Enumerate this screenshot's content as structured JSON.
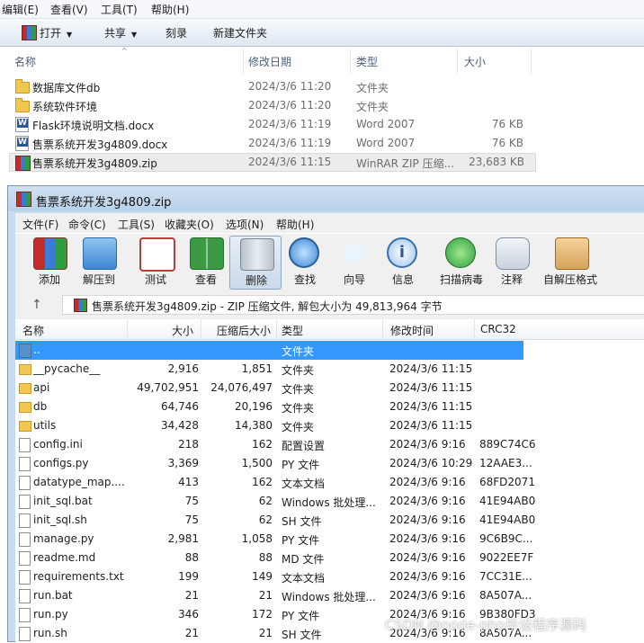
{
  "explorer": {
    "menu": [
      "编辑(E)",
      "查看(V)",
      "工具(T)",
      "帮助(H)"
    ],
    "toolbar": {
      "open": "打开",
      "share": "共享",
      "burn": "刻录",
      "new_folder": "新建文件夹"
    },
    "columns": {
      "name": "名称",
      "modified": "修改日期",
      "type": "类型",
      "size": "大小"
    },
    "rows": [
      {
        "name": "数据库文件db",
        "modified": "2024/3/6 11:20",
        "type": "文件夹",
        "size": "",
        "icon": "folder-icon"
      },
      {
        "name": "系统软件环境",
        "modified": "2024/3/6 11:20",
        "type": "文件夹",
        "size": "",
        "icon": "folder-icon"
      },
      {
        "name": "Flask环境说明文档.docx",
        "modified": "2024/3/6 11:19",
        "type": "Word 2007",
        "size": "76 KB",
        "icon": "word-document-icon"
      },
      {
        "name": "售票系统开发3g4809.docx",
        "modified": "2024/3/6 11:19",
        "type": "Word 2007",
        "size": "76 KB",
        "icon": "word-document-icon"
      },
      {
        "name": "售票系统开发3g4809.zip",
        "modified": "2024/3/6 11:15",
        "type": "WinRAR ZIP 压缩...",
        "size": "23,683 KB",
        "icon": "winrar-archive-icon"
      }
    ]
  },
  "winrar": {
    "title": "售票系统开发3g4809.zip",
    "menu": [
      "文件(F)",
      "命令(C)",
      "工具(S)",
      "收藏夹(O)",
      "选项(N)",
      "帮助(H)"
    ],
    "tools": [
      {
        "label": "添加",
        "icon": "add-archive-icon"
      },
      {
        "label": "解压到",
        "icon": "extract-to-folder-icon"
      },
      {
        "label": "测试",
        "icon": "test-checklist-icon"
      },
      {
        "label": "查看",
        "icon": "view-book-icon"
      },
      {
        "label": "删除",
        "icon": "delete-trash-icon"
      },
      {
        "label": "查找",
        "icon": "find-magnifier-icon"
      },
      {
        "label": "向导",
        "icon": "wizard-wand-icon"
      },
      {
        "label": "信息",
        "icon": "info-icon"
      },
      {
        "label": "扫描病毒",
        "icon": "virus-scan-icon"
      },
      {
        "label": "注释",
        "icon": "comment-icon"
      },
      {
        "label": "自解压格式",
        "icon": "sfx-box-icon"
      }
    ],
    "path": "售票系统开发3g4809.zip - ZIP 压缩文件, 解包大小为 49,813,964 字节",
    "columns": {
      "name": "名称",
      "size": "大小",
      "packed": "压缩后大小",
      "type": "类型",
      "modified": "修改时间",
      "crc": "CRC32"
    },
    "rows": [
      {
        "name": "..",
        "size": "",
        "packed": "",
        "type": "文件夹",
        "modified": "",
        "crc": "",
        "kind": "up"
      },
      {
        "name": "__pycache__",
        "size": "2,916",
        "packed": "1,851",
        "type": "文件夹",
        "modified": "2024/3/6 11:15",
        "crc": "",
        "kind": "folder"
      },
      {
        "name": "api",
        "size": "49,702,951",
        "packed": "24,076,497",
        "type": "文件夹",
        "modified": "2024/3/6 11:15",
        "crc": "",
        "kind": "folder"
      },
      {
        "name": "db",
        "size": "64,746",
        "packed": "20,196",
        "type": "文件夹",
        "modified": "2024/3/6 11:15",
        "crc": "",
        "kind": "folder"
      },
      {
        "name": "utils",
        "size": "34,428",
        "packed": "14,380",
        "type": "文件夹",
        "modified": "2024/3/6 11:15",
        "crc": "",
        "kind": "folder"
      },
      {
        "name": "config.ini",
        "size": "218",
        "packed": "162",
        "type": "配置设置",
        "modified": "2024/3/6 9:16",
        "crc": "889C74C6",
        "kind": "file"
      },
      {
        "name": "configs.py",
        "size": "3,369",
        "packed": "1,500",
        "type": "PY 文件",
        "modified": "2024/3/6 10:29",
        "crc": "12AAE3...",
        "kind": "file"
      },
      {
        "name": "datatype_map....",
        "size": "413",
        "packed": "162",
        "type": "文本文档",
        "modified": "2024/3/6 9:16",
        "crc": "68FD2071",
        "kind": "file"
      },
      {
        "name": "init_sql.bat",
        "size": "75",
        "packed": "62",
        "type": "Windows 批处理...",
        "modified": "2024/3/6 9:16",
        "crc": "41E94AB0",
        "kind": "file"
      },
      {
        "name": "init_sql.sh",
        "size": "75",
        "packed": "62",
        "type": "SH 文件",
        "modified": "2024/3/6 9:16",
        "crc": "41E94AB0",
        "kind": "file"
      },
      {
        "name": "manage.py",
        "size": "2,981",
        "packed": "1,058",
        "type": "PY 文件",
        "modified": "2024/3/6 9:16",
        "crc": "9C6B9C...",
        "kind": "file"
      },
      {
        "name": "readme.md",
        "size": "88",
        "packed": "88",
        "type": "MD 文件",
        "modified": "2024/3/6 9:16",
        "crc": "9022EE7F",
        "kind": "file"
      },
      {
        "name": "requirements.txt",
        "size": "199",
        "packed": "149",
        "type": "文本文档",
        "modified": "2024/3/6 9:16",
        "crc": "7CC31E...",
        "kind": "file"
      },
      {
        "name": "run.bat",
        "size": "21",
        "packed": "21",
        "type": "Windows 批处理...",
        "modified": "2024/3/6 9:16",
        "crc": "8A507A...",
        "kind": "file"
      },
      {
        "name": "run.py",
        "size": "346",
        "packed": "172",
        "type": "PY 文件",
        "modified": "2024/3/6 9:16",
        "crc": "9B380FD3",
        "kind": "file"
      },
      {
        "name": "run.sh",
        "size": "21",
        "packed": "21",
        "type": "SH 文件",
        "modified": "2024/3/6 9:16",
        "crc": "8A507A...",
        "kind": "file"
      }
    ]
  },
  "watermark": "CSDN @node-php毕设程序源码",
  "colors": {
    "selection": "#3399ff",
    "titlebar": "#c9dcee",
    "folder": "#f2c74f"
  }
}
